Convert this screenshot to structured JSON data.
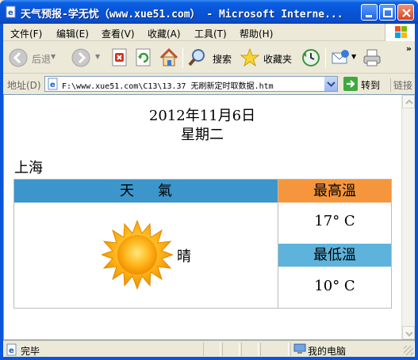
{
  "window": {
    "title": "天气预报-学无忧（www.xue51.com） - Microsoft Interne..."
  },
  "menu": {
    "items": [
      "文件(F)",
      "编辑(E)",
      "查看(V)",
      "收藏(A)",
      "工具(T)",
      "帮助(H)"
    ]
  },
  "toolbar": {
    "back_label": "后退",
    "search_label": "搜索",
    "favorites_label": "收藏夹",
    "more_glyph": "»"
  },
  "addressbar": {
    "label": "地址(D)",
    "url": "F:\\www.xue51.com\\C13\\13.37  无刷新定时取数据.htm",
    "go_label": "转到",
    "links_label": "链接"
  },
  "page": {
    "date_line": "2012年11月6日",
    "weekday": "星期二",
    "city": "上海",
    "table": {
      "weather_header": "天氣",
      "high_header": "最高溫",
      "low_header": "最低溫",
      "condition": "晴",
      "high_temp": "17° C",
      "low_temp": "10° C",
      "condition_icon": "sun-icon"
    },
    "colors": {
      "weather_header": "#3c96cb",
      "high_header": "#f6963c",
      "low_header": "#5eb3dc"
    }
  },
  "statusbar": {
    "status": "完毕",
    "zone": "我的电脑"
  }
}
